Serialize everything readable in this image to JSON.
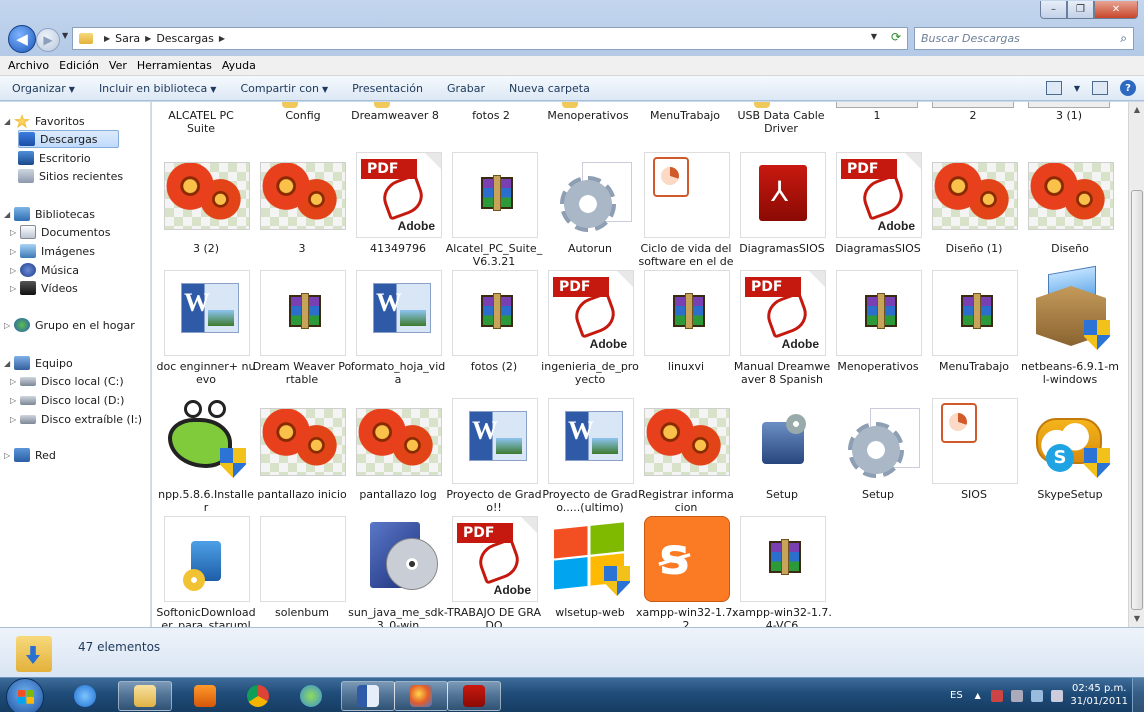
{
  "window": {
    "controls": {
      "minimize": "–",
      "maximize": "❐",
      "close": "✕"
    }
  },
  "address": {
    "crumbs": [
      "Sara",
      "Descargas"
    ],
    "search_placeholder": "Buscar Descargas"
  },
  "menu": [
    "Archivo",
    "Edición",
    "Ver",
    "Herramientas",
    "Ayuda"
  ],
  "commands": [
    "Organizar",
    "Incluir en biblioteca",
    "Compartir con",
    "Presentación",
    "Grabar",
    "Nueva carpeta"
  ],
  "nav": {
    "favoritos": "Favoritos",
    "descargas": "Descargas",
    "escritorio": "Escritorio",
    "recientes": "Sitios recientes",
    "bibliotecas": "Bibliotecas",
    "documentos": "Documentos",
    "imagenes": "Imágenes",
    "musica": "Música",
    "videos": "Vídeos",
    "hogar": "Grupo en el hogar",
    "equipo": "Equipo",
    "disco_c": "Disco local (C:)",
    "disco_d": "Disco local (D:)",
    "disco_e": "Disco extraíble (I:)",
    "red": "Red"
  },
  "top_row": [
    "ALCATEL PC Suite",
    "Config",
    "Dreamweaver 8",
    "fotos 2",
    "Menoperativos",
    "MenuTrabajo",
    "USB Data Cable Driver",
    "1",
    "2",
    "3 (1)"
  ],
  "rows": [
    [
      {
        "name": "3 (2)",
        "icon": "photo"
      },
      {
        "name": "3",
        "icon": "photo"
      },
      {
        "name": "41349796",
        "icon": "pdf"
      },
      {
        "name": "Alcatel_PC_Suite_V6.3.21",
        "icon": "rar"
      },
      {
        "name": "Autorun",
        "icon": "gear"
      },
      {
        "name": "Ciclo de vida del software en el desarrollo",
        "icon": "ppt"
      },
      {
        "name": "DiagramasSIOS",
        "icon": "acrobat"
      },
      {
        "name": "DiagramasSIOS",
        "icon": "pdf"
      },
      {
        "name": "Diseño (1)",
        "icon": "photo"
      },
      {
        "name": "Diseño",
        "icon": "photo"
      }
    ],
    [
      {
        "name": "doc enginner+ nuevo",
        "icon": "word"
      },
      {
        "name": "Dream Weaver Portable",
        "icon": "rar"
      },
      {
        "name": "formato_hoja_vida",
        "icon": "word"
      },
      {
        "name": "fotos (2)",
        "icon": "rar"
      },
      {
        "name": "ingenieria_de_proyecto",
        "icon": "pdf"
      },
      {
        "name": "linuxvi",
        "icon": "rar"
      },
      {
        "name": "Manual Dreamweaver 8 Spanish",
        "icon": "pdf"
      },
      {
        "name": "Menoperativos",
        "icon": "rar"
      },
      {
        "name": "MenuTrabajo",
        "icon": "rar"
      },
      {
        "name": "netbeans-6.9.1-ml-windows",
        "icon": "box"
      }
    ],
    [
      {
        "name": "npp.5.8.6.Installer",
        "icon": "npp"
      },
      {
        "name": "pantallazo inicio",
        "icon": "photo"
      },
      {
        "name": "pantallazo log",
        "icon": "photo"
      },
      {
        "name": "Proyecto de Grado!!",
        "icon": "word"
      },
      {
        "name": "Proyecto de Grado.....(ultimo)",
        "icon": "word"
      },
      {
        "name": "Registrar informacion",
        "icon": "photo"
      },
      {
        "name": "Setup",
        "icon": "setup"
      },
      {
        "name": "Setup",
        "icon": "gear"
      },
      {
        "name": "SIOS",
        "icon": "ppt"
      },
      {
        "name": "SkypeSetup",
        "icon": "skype"
      }
    ],
    [
      {
        "name": "SoftonicDownloader_para_staruml",
        "icon": "softonic"
      },
      {
        "name": "solenbum",
        "icon": "blank"
      },
      {
        "name": "sun_java_me_sdk-3_0-win",
        "icon": "java"
      },
      {
        "name": "TRABAJO DE GRADO",
        "icon": "pdf"
      },
      {
        "name": "wlsetup-web",
        "icon": "winlogo"
      },
      {
        "name": "xampp-win32-1.7.2",
        "icon": "xampp"
      },
      {
        "name": "xampp-win32-1.7.4-VC6",
        "icon": "rar"
      }
    ]
  ],
  "status": {
    "count": "47 elementos"
  },
  "tray": {
    "lang": "ES",
    "time": "02:45 p.m.",
    "date": "31/01/2011"
  }
}
